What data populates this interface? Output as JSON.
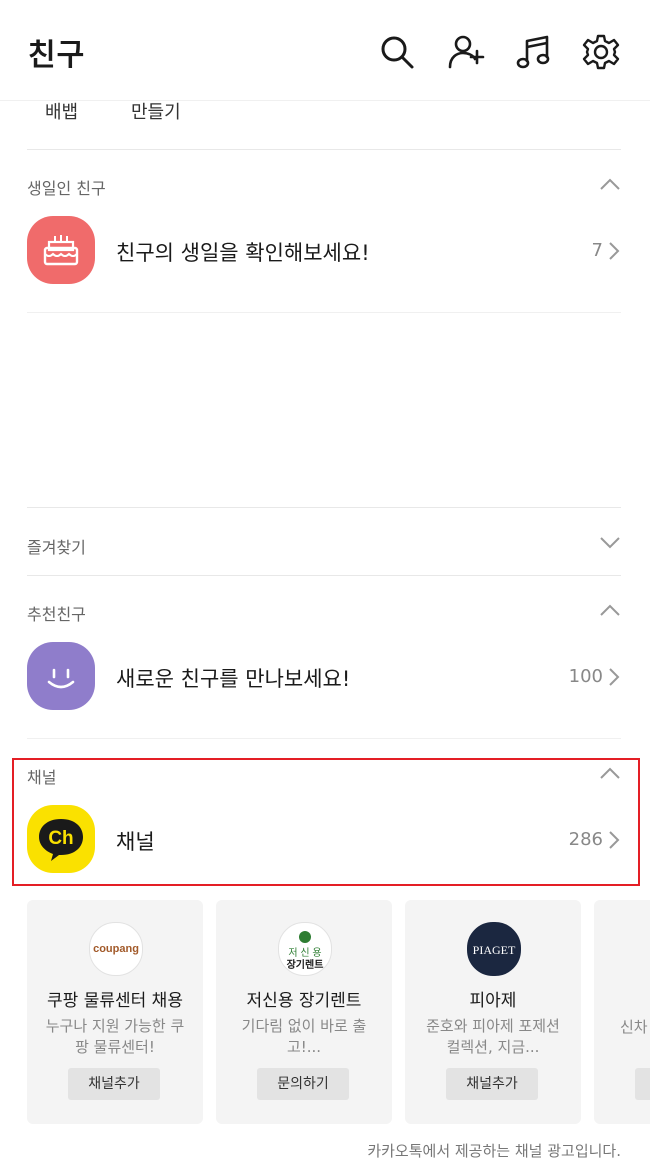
{
  "header": {
    "title": "친구"
  },
  "submenu": {
    "item1": "배뱁",
    "item2": "만들기"
  },
  "birthday": {
    "label": "생일인 친구",
    "text": "친구의 생일을 확인해보세요!",
    "count": "7"
  },
  "favorites": {
    "label": "즐겨찾기"
  },
  "recommended": {
    "label": "추천친구",
    "text": "새로운 친구를 만나보세요!",
    "count": "100"
  },
  "channel": {
    "label": "채널",
    "text": "채널",
    "count": "286",
    "logo_text": "Ch"
  },
  "cards": [
    {
      "logo": "coupang",
      "name": "쿠팡 물류센터 채용",
      "desc": "누구나 지원 가능한 쿠팡 물류센터!",
      "button": "채널추가"
    },
    {
      "logo_line1": "저 신 용",
      "logo_line2": "장기렌트",
      "name": "저신용 장기렌트",
      "desc": "기다림 없이 바로 출고!...",
      "button": "문의하기"
    },
    {
      "logo": "PIAGET",
      "name": "피아제",
      "desc": "준호와 피아제 포제션 컬렉션, 지금...",
      "button": "채널추가"
    },
    {
      "desc_partial": "신차"
    }
  ],
  "ad_note": "카카오톡에서 제공하는 채널 광고입니다.",
  "colors": {
    "accent_red": "#e41e25",
    "birthday": "#f06b6b",
    "recommend": "#8f7dcb",
    "channel_yellow": "#fae100"
  },
  "icons": [
    "search-icon",
    "add-friend-icon",
    "music-icon",
    "settings-icon",
    "cake-icon",
    "smile-icon",
    "chevron-up-icon",
    "chevron-down-icon",
    "chevron-right-icon"
  ]
}
